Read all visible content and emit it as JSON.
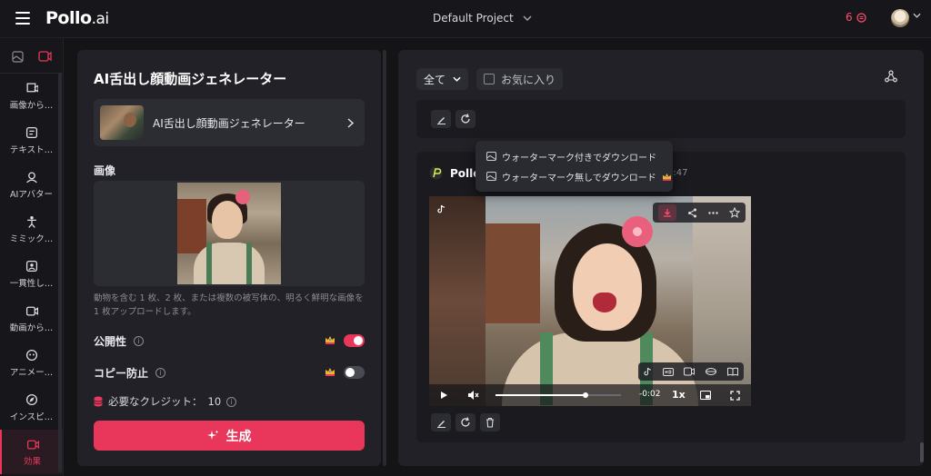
{
  "topbar": {
    "brand": "Pollo",
    "brand_suffix": ".ai",
    "project": "Default Project",
    "credits": "6"
  },
  "rail": {
    "tabs": [
      "image-icon",
      "video-icon"
    ],
    "items": [
      {
        "label": "画像から…",
        "icon": "image-to-video-icon"
      },
      {
        "label": "テキスト…",
        "icon": "text-to-video-icon"
      },
      {
        "label": "AIアバター",
        "icon": "avatar-icon"
      },
      {
        "label": "ミミック…",
        "icon": "mimic-icon"
      },
      {
        "label": "一貫性し…",
        "icon": "consistency-icon"
      },
      {
        "label": "動画から…",
        "icon": "video-to-video-icon"
      },
      {
        "label": "アニメー…",
        "icon": "anime-icon"
      },
      {
        "label": "インスピ…",
        "icon": "inspiration-icon"
      },
      {
        "label": "効果",
        "icon": "effects-icon",
        "active": true
      }
    ]
  },
  "left": {
    "title": "AI舌出し顔動画ジェネレーター",
    "model_name": "AI舌出し顔動画ジェネレーター",
    "image_label": "画像",
    "hint": "動物を含む 1 枚、2 枚、または複数の被写体の、明るく鮮明な画像を 1 枚アップロードします。",
    "public_label": "公開性",
    "copy_label": "コピー防止",
    "credit_label": "必要なクレジット：",
    "credit_value": "10",
    "generate_label": "生成",
    "public_on": true,
    "copy_on": false
  },
  "right": {
    "filter_label": "全て",
    "fav_label": "お気に入り",
    "gen_name": "Pollo",
    "gen_time": "3:47",
    "video_time": "-0:02",
    "video_speed": "1x",
    "progress": 0.72,
    "menu": [
      "ウォーターマーク付きでダウンロード",
      "ウォーターマーク無しでダウンロード"
    ]
  },
  "colors": {
    "accent": "#e8375a",
    "panel": "#212127",
    "bg": "#141417"
  }
}
